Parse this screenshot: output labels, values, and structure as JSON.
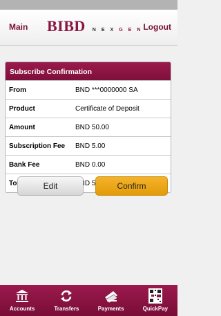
{
  "header": {
    "main_label": "Main",
    "logo_text": "BIBD",
    "logo_sub": [
      "N",
      "E",
      "X",
      "G",
      "E",
      "N"
    ],
    "logo_sub_colors": [
      "#2a2a2a",
      "#2a2a2a",
      "#2a2a2a",
      "#8a1541",
      "#8a1541",
      "#8a1541"
    ],
    "logout_label": "Logout"
  },
  "confirmation": {
    "title": "Subscribe Confirmation",
    "rows": [
      {
        "label": "From",
        "value": "BND ***0000000 SA"
      },
      {
        "label": "Product",
        "value": "Certificate of Deposit"
      },
      {
        "label": "Amount",
        "value": "BND 50.00"
      },
      {
        "label": "Subscription Fee",
        "value": "BND 5.00"
      },
      {
        "label": "Bank Fee",
        "value": "BND 0.00"
      },
      {
        "label": "Total",
        "value": "BND 55.00"
      }
    ]
  },
  "actions": {
    "edit_label": "Edit",
    "confirm_label": "Confirm"
  },
  "tabbar": {
    "items": [
      {
        "label": "Accounts",
        "icon": "bank-icon"
      },
      {
        "label": "Transfers",
        "icon": "transfer-arrows-icon"
      },
      {
        "label": "Payments",
        "icon": "cash-icon"
      },
      {
        "label": "QuickPay",
        "icon": "qr-code-icon"
      }
    ]
  },
  "colors": {
    "brand": "#8a1541",
    "accent": "#f4b32c"
  }
}
